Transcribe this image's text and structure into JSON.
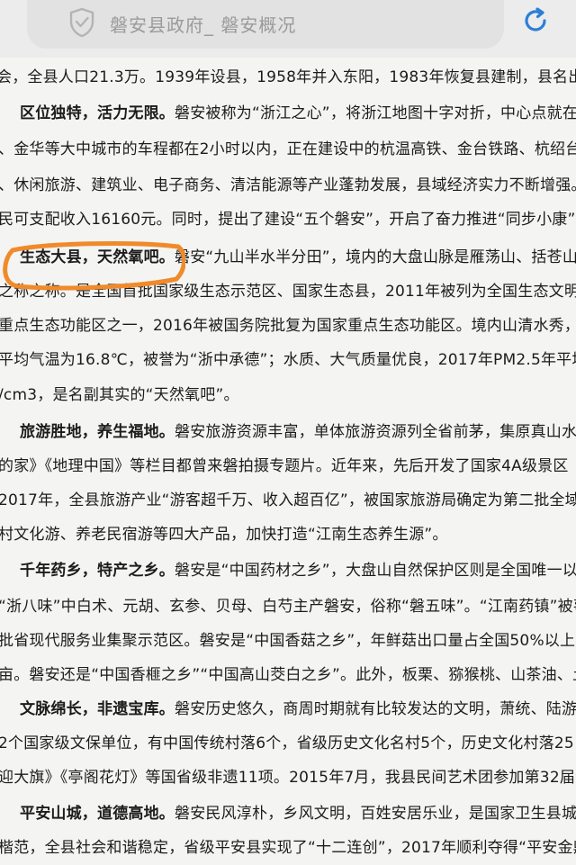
{
  "address_bar": {
    "title": "磐安县政府_ 磐安概况"
  },
  "paragraph_lines": [
    {
      "text": "会，全县人口21.3万。1939年设县，1958年并入东阳，1983年恢复县建制，县名出自《"
    },
    {
      "heading": "区位独特，活力无限。",
      "text": "磐安被称为“浙江之心”，将浙江地图十字对折，中心点就在磐"
    },
    {
      "text": "、金华等大中城市的车程都在2小时以内，正在建设中的杭温高铁、金台铁路、杭绍台"
    },
    {
      "text": "、休闲旅游、建筑业、电子商务、清洁能源等产业蓬勃发展，县域经济实力不断增强。"
    },
    {
      "text": "民可支配收入16160元。同时，提出了建设“五个磐安”，开启了奋力推进“同步小康”建设"
    },
    {
      "heading": "生态大县，天然氧吧。",
      "text": "磐安“九山半水半分田”，境内的大盘山脉是雁荡山、括苍山、"
    },
    {
      "text": "之称之称。是全国首批国家级生态示范区、国家生态县，2011年被列为全国生态文明"
    },
    {
      "text": "重点生态功能区之一，2016年被国务院批复为国家重点生态功能区。境内山清水秀，"
    },
    {
      "text": "平均气温为16.8℃，被誉为“浙中承德”；水质、大气质量优良，2017年PM2.5年平均浓"
    },
    {
      "text": "/cm3，是名副其实的“天然氧吧”。"
    },
    {
      "heading": "旅游胜地，养生福地。",
      "text": "磐安旅游资源丰富，单体旅游资源列全省前茅，集原真山水、"
    },
    {
      "text": "的家》《地理中国》等栏目都曾来磐拍摄专题片。近年来，先后开发了国家4A级景区"
    },
    {
      "text": "2017年，全县旅游产业“游客超千万、收入超百亿”，被国家旅游局确定为第二批全域"
    },
    {
      "text": "村文化游、养老民宿游等四大产品，加快打造“江南生态养生源”。"
    },
    {
      "heading": "千年药乡，特产之乡。",
      "text": "磐安是“中国药材之乡”，大盘山自然保护区则是全国唯一以"
    },
    {
      "text": "“浙八味”中白术、元胡、玄参、贝母、白芍主产磐安，俗称“磐五味”。“江南药镇”被확"
    },
    {
      "text": "批省现代服务业集聚示范区。磐安是“中国香菇之乡”，年鲜菇出口量占全国50%以上。"
    },
    {
      "text": "亩。磐安还是“中国香榧之乡”“中国高山茭白之乡”。此外，板栗、猕猴桃、山茶油、土鸡"
    },
    {
      "heading": "文脉绵长，非遗宝库。",
      "text": "磐安历史悠久，商周时期就有比较发达的文明，萧统、陆游、"
    },
    {
      "text": "2个国家级文保单位，有中国传统村落6个，省级历史文化名村5个，历史文化村落25"
    },
    {
      "text": "迎大旗》《亭阁花灯》等国省级非遗11项。2015年7月，我县民间艺术团参加第32届法"
    },
    {
      "heading": "平安山城，道德高地。",
      "text": "磐安民风淳朴，乡风文明，百姓安居乐业，是国家卫生县城、"
    },
    {
      "text": "楷范，全县社会和谐稳定，省级平安县实现了“十二连创”，2017年顺利夺得“平安金鼎”"
    }
  ]
}
